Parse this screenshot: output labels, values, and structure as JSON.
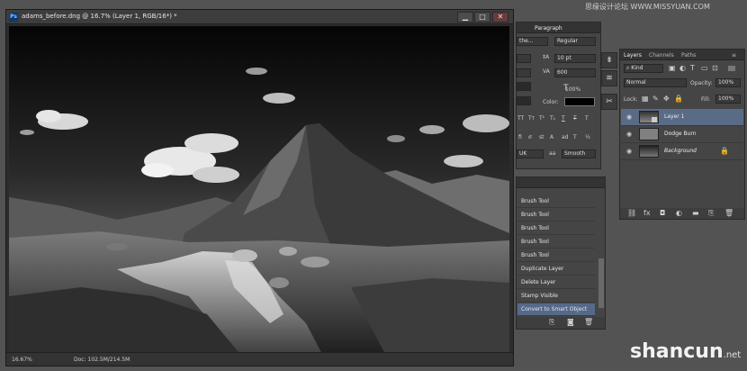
{
  "document": {
    "title": "adams_before.dng @ 16.7% (Layer 1, RGB/16*) *",
    "app_icon": "Ps",
    "zoom": "16.67%",
    "doc_info": "Doc: 102.5M/214.5M"
  },
  "window_buttons": {
    "minimize": "▁",
    "maximize": "□",
    "close": "✕"
  },
  "watermark_top": "思缘设计论坛  WWW.MISSYUAN.COM",
  "character_panel": {
    "tab": "Paragraph",
    "font_style_prefix": "the...",
    "font_style": "Regular",
    "leading": "10 pt",
    "tracking": "600",
    "vertical_scale": "100%",
    "color_label": "Color:",
    "style_buttons": [
      "TT",
      "Tт",
      "T¹",
      "T₁",
      "T",
      "T",
      "T"
    ],
    "language": "UK",
    "antialias": "Smooth",
    "aa_label": "aa"
  },
  "history_panel": {
    "items": [
      "Brush Tool",
      "Brush Tool",
      "Brush Tool",
      "Brush Tool",
      "Brush Tool",
      "Duplicate Layer",
      "Delete Layer",
      "Stamp Visible",
      "Convert to Smart Object"
    ]
  },
  "layers_panel": {
    "tabs": [
      "Layers",
      "Channels",
      "Paths"
    ],
    "filter": "Kind",
    "blend_mode": "Normal",
    "opacity_label": "Opacity:",
    "opacity": "100%",
    "lock_label": "Lock:",
    "fill_label": "Fill:",
    "fill": "100%",
    "layers": [
      {
        "name": "Layer 1",
        "selected": true
      },
      {
        "name": "Dodge Burn",
        "selected": false
      },
      {
        "name": "Background",
        "selected": false
      }
    ]
  },
  "watermark_bottom": {
    "brand": "shancun",
    "suffix": ".net"
  }
}
